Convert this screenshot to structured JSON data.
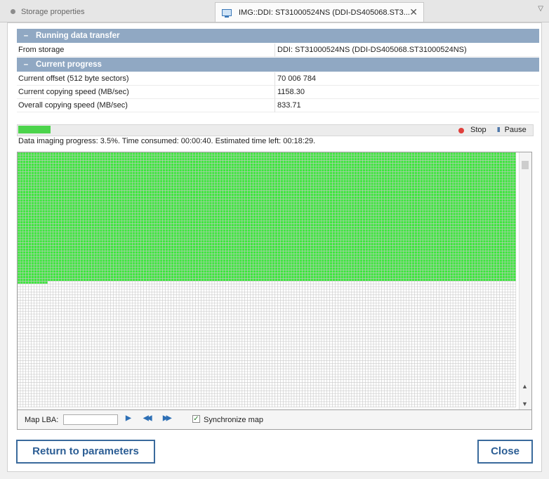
{
  "tabs": {
    "inactive_label": "Storage properties",
    "active_label": "IMG::DDI: ST31000524NS (DDI-DS405068.ST3...",
    "close_glyph": "✕",
    "menu_glyph": "▽"
  },
  "running": {
    "header": "Running data transfer",
    "collapse_glyph": "–",
    "rows": [
      {
        "key": "From storage",
        "value": "DDI: ST31000524NS (DDI-DS405068.ST31000524NS)"
      }
    ]
  },
  "progress_section": {
    "header": "Current progress",
    "collapse_glyph": "–",
    "rows": [
      {
        "key": "Current offset (512 byte sectors)",
        "value": "70 006 784"
      },
      {
        "key": "Current copying speed (MB/sec)",
        "value": "1158.30"
      },
      {
        "key": "Overall copying speed (MB/sec)",
        "value": "833.71"
      }
    ]
  },
  "progress_bar": {
    "percent": 3.5,
    "stop_label": "Stop",
    "pause_label": "Pause",
    "pause_glyph": "II",
    "fill_color": "#4cd44c",
    "stop_color": "#e0403c"
  },
  "status_text": "Data imaging progress: 3.5%. Time consumed: 00:00:40. Estimated time left: 00:18:29.",
  "map": {
    "filled_cells_fraction": 0.506,
    "filled_color": "#3ee63e",
    "empty_color": "#ffffff",
    "lba_label": "Map LBA:",
    "lba_value": "",
    "play_glyph": "▶",
    "rewind_glyph": "◀◀",
    "forward_glyph": "▶▶",
    "sync_label": "Synchronize map",
    "sync_checked": true,
    "check_glyph": "✓",
    "scroll_up_glyph": "▲",
    "scroll_down_glyph": "▼"
  },
  "buttons": {
    "return_label": "Return to parameters",
    "close_label": "Close"
  }
}
